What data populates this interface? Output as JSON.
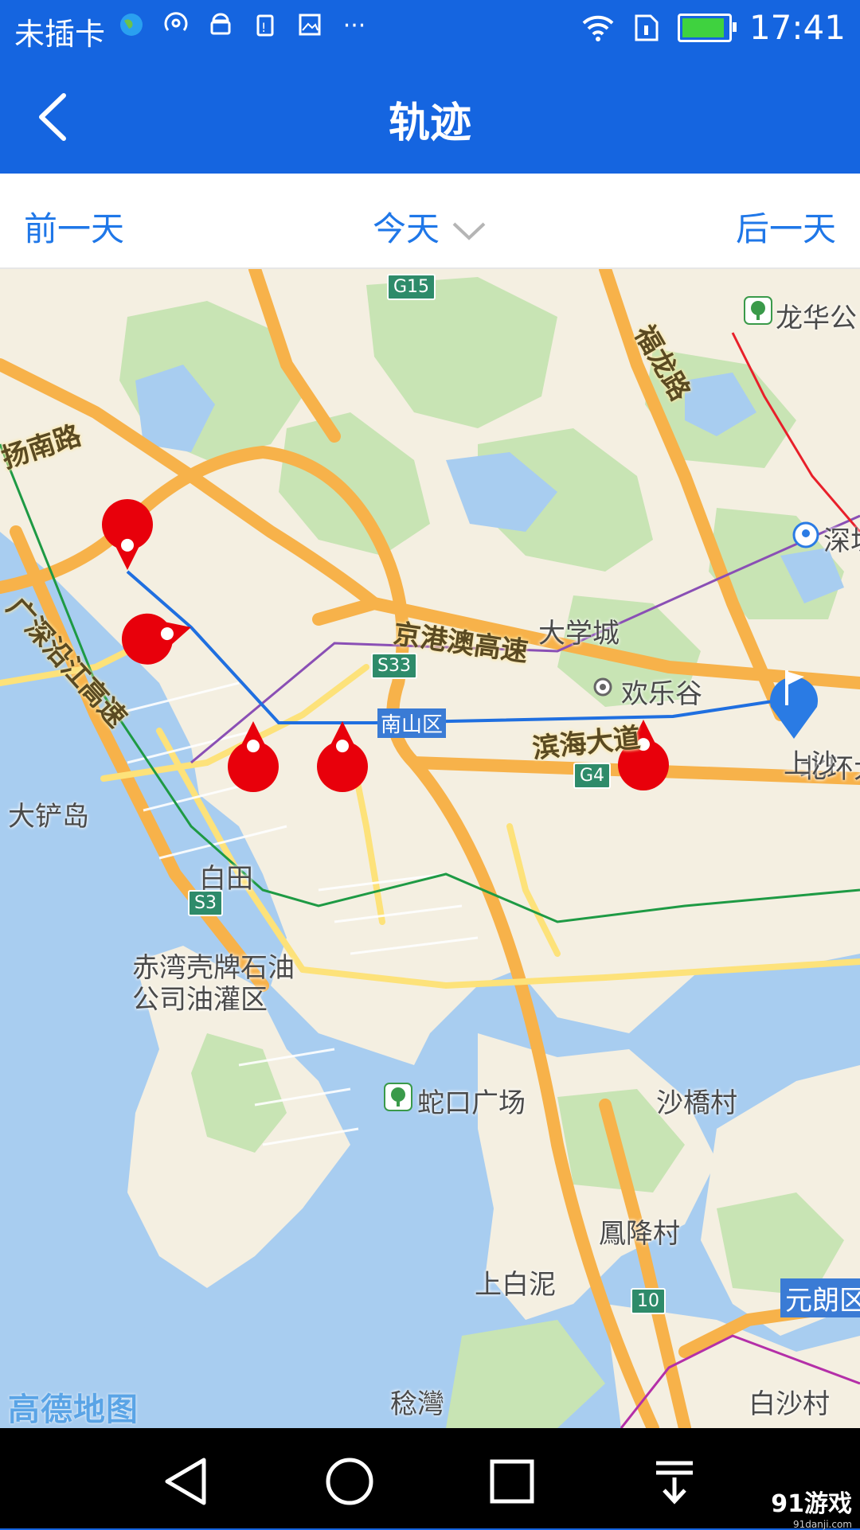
{
  "status_bar": {
    "carrier": "未插卡",
    "time": "17:41",
    "icons": [
      "earth-icon",
      "hotspot-icon",
      "android-icon",
      "warning-icon",
      "image-icon",
      "more-icon",
      "wifi-icon",
      "sim-icon",
      "battery-icon"
    ]
  },
  "header": {
    "title": "轨迹"
  },
  "day_selector": {
    "prev_label": "前一天",
    "current_label": "今天",
    "next_label": "后一天"
  },
  "map": {
    "provider_logo": "高德地图",
    "place_labels": [
      "龙华公",
      "深圳",
      "大学城",
      "北环大",
      "欢乐谷",
      "上沙",
      "大铲岛",
      "白田",
      "蛇口广场",
      "沙橋村",
      "赤湾壳牌石油公司油灌区",
      "鳳降村",
      "上白泥",
      "元朗区",
      "白沙村",
      "稔灣",
      "福龙路",
      "扬南路",
      "广深沿江高速",
      "京港澳高速",
      "滨海大道",
      "南山区"
    ],
    "road_shields": [
      "G15",
      "S33",
      "G4",
      "S3",
      "10"
    ],
    "track_markers": 5,
    "end_marker": "flag"
  },
  "nav_bar": {
    "buttons": [
      "back-icon",
      "home-icon",
      "recents-icon",
      "notification-pull-icon"
    ]
  },
  "watermark": {
    "brand": "91游戏",
    "url": "91danji.com"
  },
  "colors": {
    "primary": "#1565e0",
    "accent_text": "#1f77e8",
    "track_line": "#1f6fe0",
    "marker_red": "#e8000b",
    "flag_blue": "#2a7be4"
  }
}
